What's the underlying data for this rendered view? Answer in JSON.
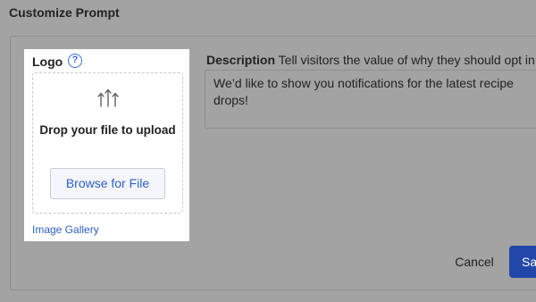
{
  "page": {
    "title": "Customize Prompt"
  },
  "logo": {
    "label": "Logo",
    "help_icon": "?",
    "drop_text": "Drop your file to upload",
    "upload_icon": "upload-arrows-icon",
    "browse_label": "Browse for File",
    "gallery_link": "Image Gallery"
  },
  "description": {
    "label": "Description",
    "hint": "Tell visitors the value of why they should opt in",
    "value": "We’d like to show you notifications for the latest recipe drops!"
  },
  "actions": {
    "cancel_label": "Cancel",
    "save_label": "Sa"
  },
  "colors": {
    "accent": "#2b5fc4",
    "primary_button": "#2347a8",
    "overlay": "#a3a3a3"
  }
}
